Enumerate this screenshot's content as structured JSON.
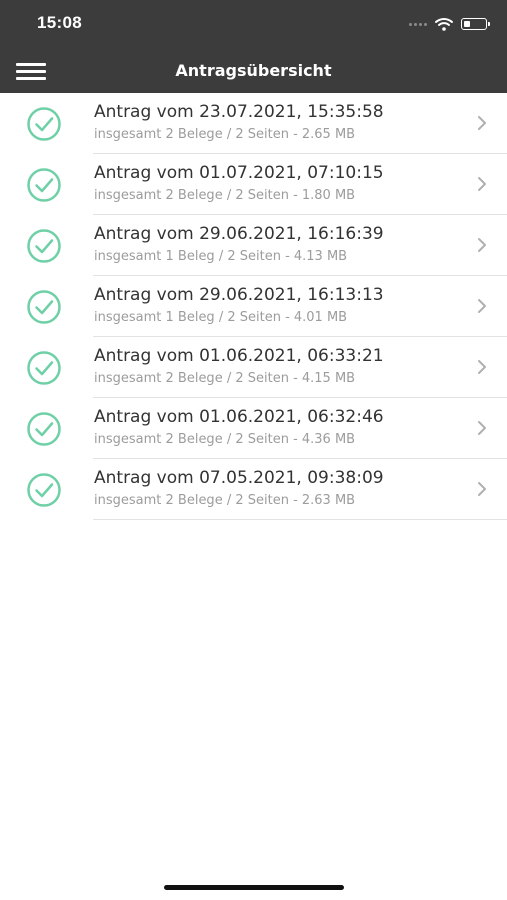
{
  "status_bar": {
    "time": "15:08"
  },
  "header": {
    "title": "Antragsübersicht",
    "menu_icon": "hamburger-menu-icon"
  },
  "applications": [
    {
      "title": "Antrag vom 23.07.2021, 15:35:58",
      "subtitle": "insgesamt 2 Belege / 2 Seiten - 2.65 MB",
      "status_icon": "check-circle-icon"
    },
    {
      "title": "Antrag vom 01.07.2021, 07:10:15",
      "subtitle": "insgesamt 2 Belege / 2 Seiten - 1.80 MB",
      "status_icon": "check-circle-icon"
    },
    {
      "title": "Antrag vom 29.06.2021, 16:16:39",
      "subtitle": "insgesamt 1 Beleg / 2 Seiten - 4.13 MB",
      "status_icon": "check-circle-icon"
    },
    {
      "title": "Antrag vom 29.06.2021, 16:13:13",
      "subtitle": "insgesamt 1 Beleg / 2 Seiten - 4.01 MB",
      "status_icon": "check-circle-icon"
    },
    {
      "title": "Antrag vom 01.06.2021, 06:33:21",
      "subtitle": "insgesamt 2 Belege / 2 Seiten - 4.15 MB",
      "status_icon": "check-circle-icon"
    },
    {
      "title": "Antrag vom 01.06.2021, 06:32:46",
      "subtitle": "insgesamt 2 Belege / 2 Seiten - 4.36 MB",
      "status_icon": "check-circle-icon"
    },
    {
      "title": "Antrag vom 07.05.2021, 09:38:09",
      "subtitle": "insgesamt 2 Belege / 2 Seiten - 2.63 MB",
      "status_icon": "check-circle-icon"
    }
  ],
  "colors": {
    "header_bg": "#3c3c3c",
    "check_accent": "#6fd0a7",
    "title_text": "#333333",
    "subtitle_text": "#9c9c9c",
    "chevron": "#b0b0b0"
  }
}
